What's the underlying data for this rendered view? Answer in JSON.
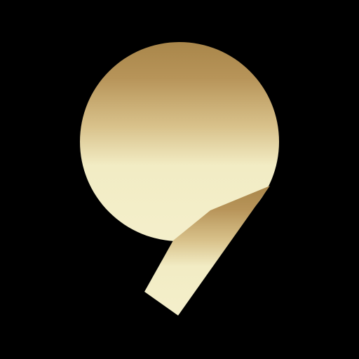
{
  "background_color": "#000000",
  "logo": {
    "name": "gold-nine-logo-icon",
    "gradient_colors": {
      "top": "#a9864a",
      "upper_mid": "#b79459",
      "mid": "#d8c18a",
      "lower": "#f2ecc4",
      "bottom": "#f4efcb"
    }
  }
}
